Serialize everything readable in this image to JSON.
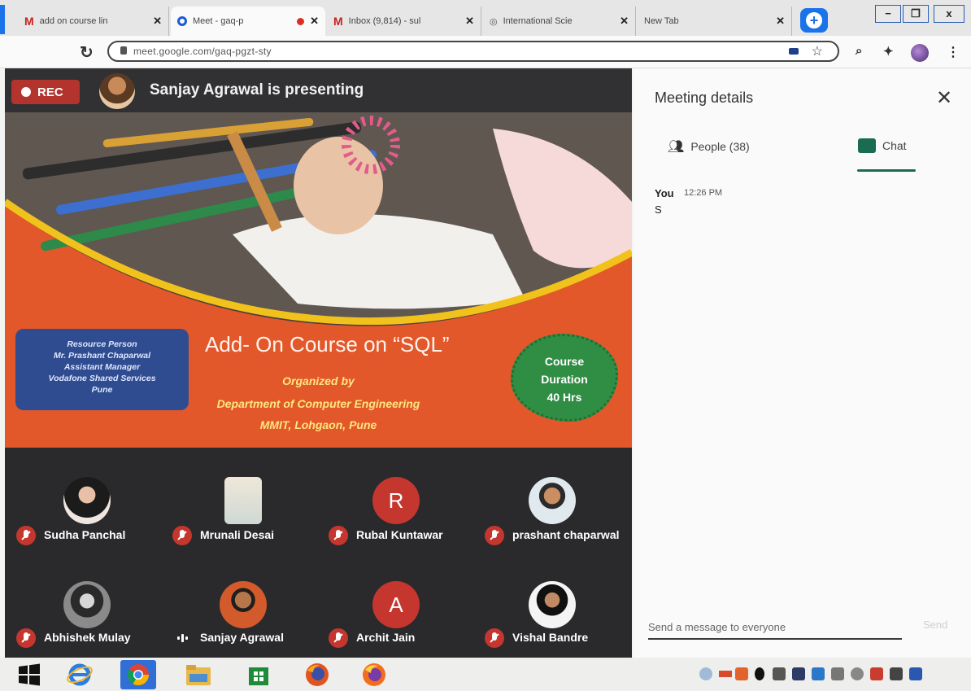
{
  "browser": {
    "tabs": [
      {
        "title": "add on course lin",
        "favicon": "gmail-icon"
      },
      {
        "title": "Meet - gaq-p",
        "favicon": "meet-icon",
        "recording": true,
        "active": true
      },
      {
        "title": "Inbox (9,814) - sul",
        "favicon": "gmail-icon"
      },
      {
        "title": "International Scie",
        "favicon": "globe-icon"
      },
      {
        "title": "New Tab",
        "favicon": ""
      }
    ],
    "url": "meet.google.com/gaq-pgzt-sty",
    "window_controls": {
      "minimize": "−",
      "restore": "❐",
      "close": "x"
    }
  },
  "meeting": {
    "rec_label": "REC",
    "presenting_text": "Sanjay Agrawal is presenting",
    "slide": {
      "resource_person": [
        "Resource Person",
        "Mr. Prashant Chaparwal",
        "Assistant Manager",
        "Vodafone Shared Services",
        "Pune"
      ],
      "title": "Add- On Course on “SQL”",
      "organized_by": "Organized by",
      "department": "Department of Computer Engineering",
      "institute": "MMIT, Lohgaon, Pune",
      "duration": [
        "Course",
        "Duration",
        "40 Hrs"
      ]
    },
    "participants": [
      {
        "name": "Sudha Panchal",
        "avatar": "photo",
        "muted": true
      },
      {
        "name": "Mrunali Desai",
        "avatar": "photo",
        "muted": true
      },
      {
        "name": "Rubal Kuntawar",
        "avatar": "R",
        "muted": true
      },
      {
        "name": "prashant chaparwal",
        "avatar": "photo",
        "muted": true
      },
      {
        "name": "Abhishek Mulay",
        "avatar": "photo",
        "muted": true
      },
      {
        "name": "Sanjay Agrawal",
        "avatar": "photo",
        "muted": false
      },
      {
        "name": "Archit Jain",
        "avatar": "A",
        "muted": true
      },
      {
        "name": "Vishal Bandre",
        "avatar": "photo",
        "muted": true
      }
    ]
  },
  "panel": {
    "title": "Meeting details",
    "people_tab": "People (38)",
    "chat_tab": "Chat",
    "messages": [
      {
        "sender": "You",
        "time": "12:26 PM",
        "text": "S"
      }
    ],
    "input_placeholder": "Send a message to everyone",
    "send_label": "Send"
  },
  "colors": {
    "accent_blue": "#1a73e8",
    "rec_red": "#c5362f",
    "slide_orange": "#e2582a",
    "chat_green": "#1a6b52",
    "duration_green": "#2f8e44"
  }
}
